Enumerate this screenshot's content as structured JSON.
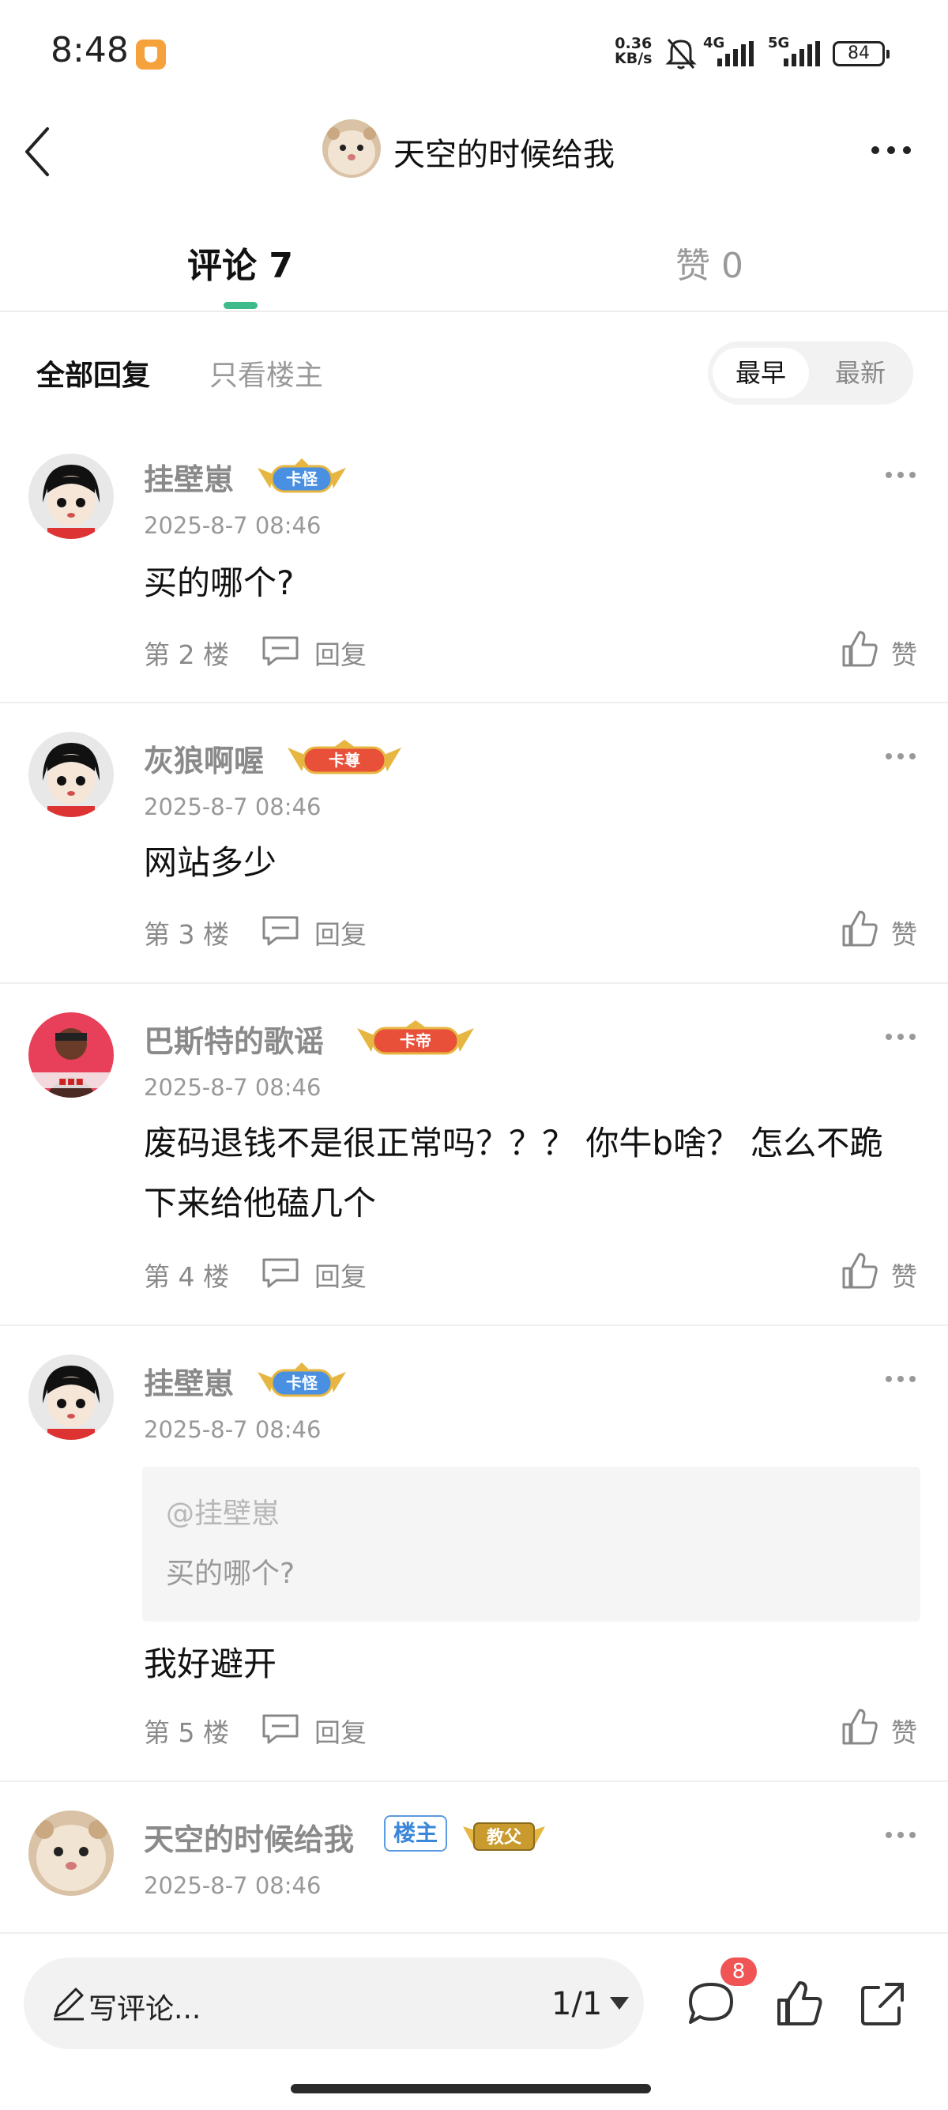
{
  "status_bar": {
    "time": "8:48",
    "net_speed_value": "0.36",
    "net_speed_unit": "KB/s",
    "signal_1": "4G",
    "signal_2": "5G",
    "battery": "84"
  },
  "header": {
    "title": "天空的时候给我"
  },
  "tabs": {
    "comments": "评论 7",
    "likes": "赞 0"
  },
  "filter": {
    "all": "全部回复",
    "op_only": "只看楼主",
    "sort_earliest": "最早",
    "sort_latest": "最新"
  },
  "comments": [
    {
      "name": "挂壁崽",
      "badge": "卡怪",
      "badge_color": "#4a90e2",
      "time": "2025-8-7 08:46",
      "text": "买的哪个?",
      "floor": "第 2 楼",
      "reply": "回复",
      "like": "赞"
    },
    {
      "name": "灰狼啊喔",
      "badge": "卡尊",
      "badge_color": "#e8503a",
      "time": "2025-8-7 08:46",
      "text": "网站多少",
      "floor": "第 3 楼",
      "reply": "回复",
      "like": "赞"
    },
    {
      "name": "巴斯特的歌谣",
      "badge": "卡帝",
      "badge_color": "#e8503a",
      "time": "2025-8-7 08:46",
      "text": "废码退钱不是很正常吗？？？ 你牛b啥？ 怎么不跪下来给他磕几个",
      "floor": "第 4 楼",
      "reply": "回复",
      "like": "赞"
    },
    {
      "name": "挂壁崽",
      "badge": "卡怪",
      "badge_color": "#4a90e2",
      "time": "2025-8-7 08:46",
      "quote_at": "@挂壁崽",
      "quote_text": "买的哪个?",
      "text": "我好避开",
      "floor": "第 5 楼",
      "reply": "回复",
      "like": "赞"
    },
    {
      "name": "天空的时候给我",
      "host_tag": "楼主",
      "badge": "教父",
      "badge_color": "#c99a2e",
      "time": "2025-8-7 08:46"
    }
  ],
  "bottom_bar": {
    "composer_placeholder": "写评论...",
    "page": "1/1",
    "comment_count": "8"
  },
  "icons": {
    "back": "chevron-left-icon",
    "more": "more-dots-icon",
    "reply": "reply-bubble-icon",
    "like": "thumbs-up-icon",
    "pen": "pen-icon",
    "comment": "comment-bubble-icon",
    "share": "share-icon"
  },
  "colors": {
    "accent": "#3dbb8a",
    "badge_red": "#f05454",
    "host_tag_blue": "#3a86d8"
  }
}
